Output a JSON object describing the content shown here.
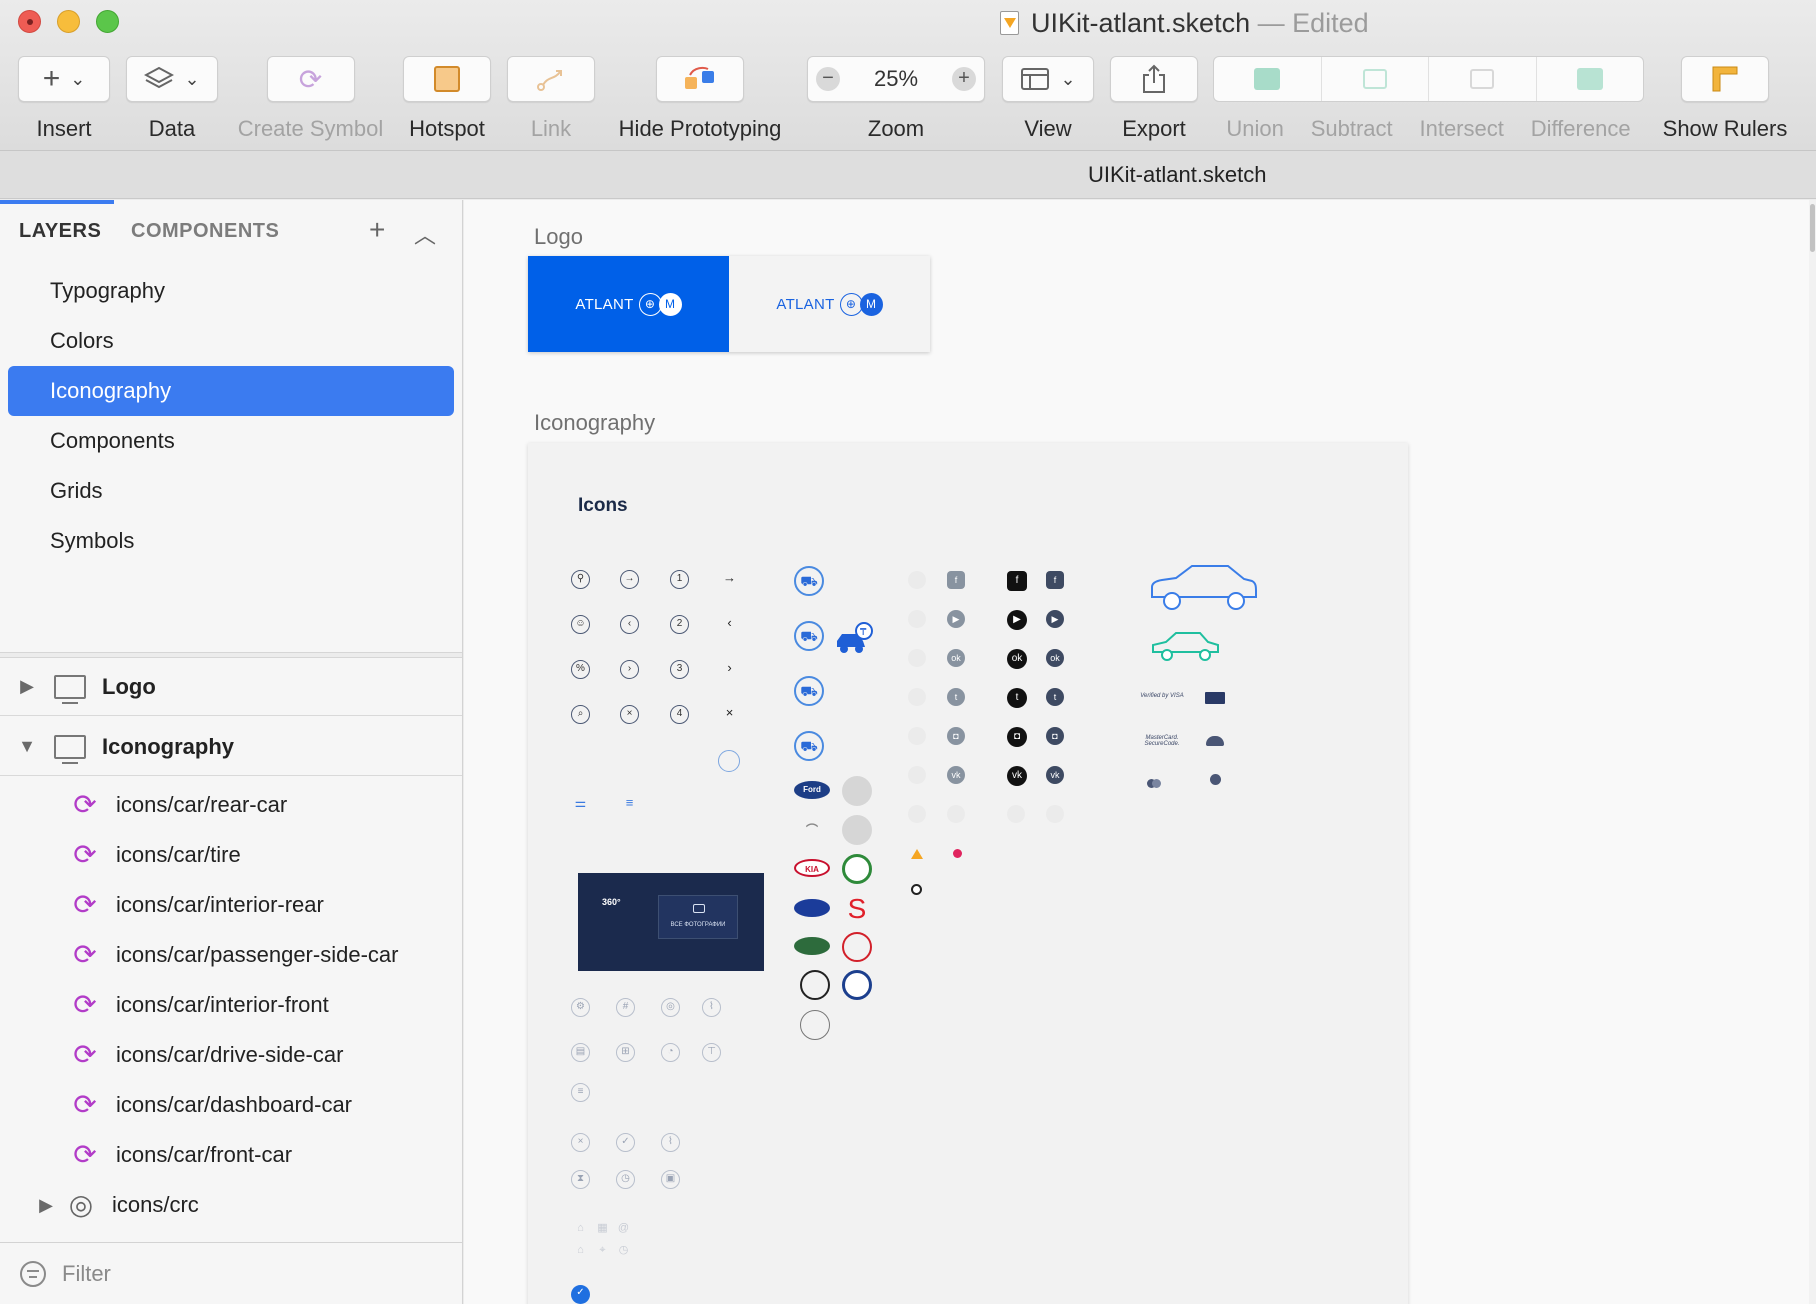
{
  "window": {
    "title": "UIKit-atlant.sketch",
    "edited_suffix": "— Edited",
    "document_title": "UIKit-atlant.sketch"
  },
  "toolbar": {
    "insert": "Insert",
    "data": "Data",
    "create_symbol": "Create Symbol",
    "hotspot": "Hotspot",
    "link": "Link",
    "hide_prototyping": "Hide Prototyping",
    "zoom": "Zoom",
    "zoom_value": "25%",
    "view": "View",
    "export": "Export",
    "union": "Union",
    "subtract": "Subtract",
    "intersect": "Intersect",
    "difference": "Difference",
    "show_rulers": "Show Rulers"
  },
  "sidebar": {
    "tabs": {
      "layers": "LAYERS",
      "components": "COMPONENTS"
    },
    "pages": [
      "Typography",
      "Colors",
      "Iconography",
      "Components",
      "Grids",
      "Symbols"
    ],
    "selected_page": "Iconography",
    "artboards": [
      "Logo",
      "Iconography"
    ],
    "layers": [
      "icons/car/rear-car",
      "icons/car/tire",
      "icons/car/interior-rear",
      "icons/car/passenger-side-car",
      "icons/car/interior-front",
      "icons/car/drive-side-car",
      "icons/car/dashboard-car",
      "icons/car/front-car",
      "icons/crc"
    ],
    "filter_placeholder": "Filter"
  },
  "canvas": {
    "logo_label": "Logo",
    "logo_text": "ATLANT",
    "logo_badge": "M",
    "iconography_label": "Iconography",
    "icons_heading": "Icons",
    "numbers": [
      "1",
      "2",
      "3",
      "4"
    ],
    "photo_label_360": "360°",
    "photo_label_all": "ВСЕ ФОТОГРАФИИ",
    "brands": [
      "Ford",
      "KIA"
    ],
    "payments": [
      "Verified by VISA",
      "MasterCard. SecureCode."
    ]
  },
  "colors": {
    "accent": "#3b7bf0",
    "logo_blue": "#0060e8",
    "symbol_purple": "#b23cc8",
    "dark_navy": "#1b2a4d"
  }
}
